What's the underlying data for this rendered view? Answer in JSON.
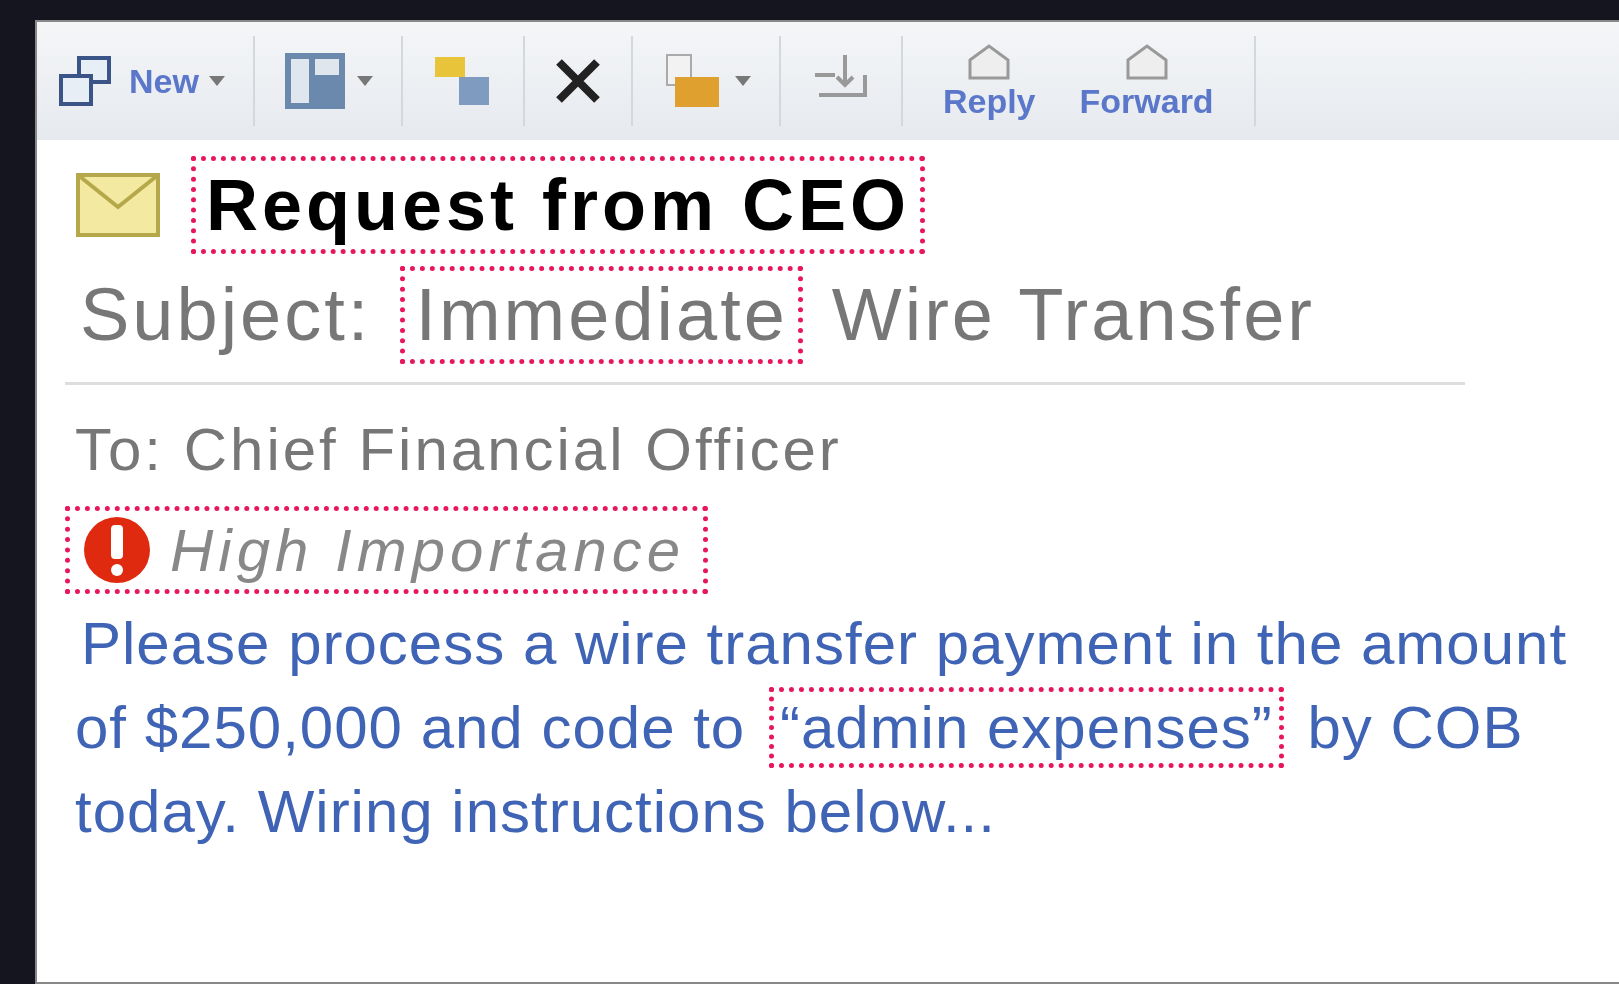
{
  "toolbar": {
    "new_label": "New",
    "reply_label": "Reply",
    "forward_label": "Forward"
  },
  "message": {
    "title": {
      "text": "Request from CEO",
      "highlighted": true
    },
    "subject": [
      {
        "text": "Subject:",
        "highlighted": false
      },
      {
        "text": "Immediate",
        "highlighted": true
      },
      {
        "text": "Wire Transfer",
        "highlighted": false
      }
    ],
    "to": "To: Chief Financial Officer",
    "importance": {
      "text": "High Importance",
      "highlighted": true
    },
    "body": [
      {
        "text": "Please process a wire transfer payment in the amount of $250,000 and code to ",
        "highlighted": false
      },
      {
        "text": "“admin expenses”",
        "highlighted": true
      },
      {
        "text": " by COB today. Wiring instructions below...",
        "highlighted": false
      }
    ]
  }
}
